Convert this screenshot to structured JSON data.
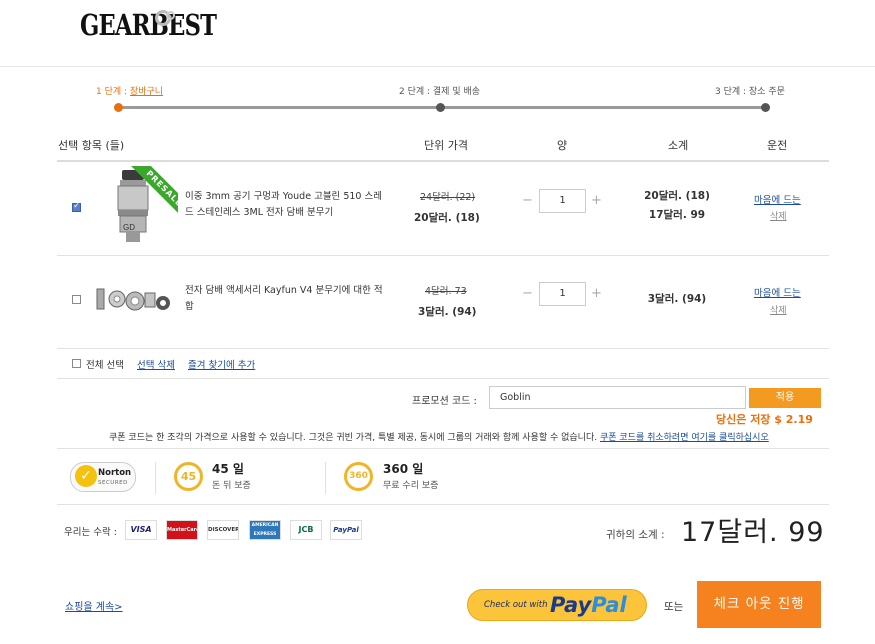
{
  "header": {
    "logo": "GEARBEST"
  },
  "steps": [
    {
      "num": "1 단계 :",
      "label": "장바구니"
    },
    {
      "num": "",
      "label": "2 단계 : 결제 및 배송"
    },
    {
      "num": "",
      "label": "3 단계 : 장소 주문"
    }
  ],
  "table_headers": [
    "선택 항목 (들)",
    "단위 가격",
    "양",
    "소계",
    "운전"
  ],
  "items": [
    {
      "checked": true,
      "badge": "PRESALE",
      "name": "이중 3mm 공기 구멍과 Youde 고블린 510 스레드 스테인레스 3ML 전자 담배 분무기",
      "old_price": "24달러. (22)",
      "new_price": "20달러. (18)",
      "qty": "1",
      "subtotal_line1": "20달러. (18)",
      "subtotal_line2": "17달러. 99",
      "wishlist": "마음에 드는",
      "delete": "삭제"
    },
    {
      "checked": false,
      "name": "전자 담배 액세서리 Kayfun V4 분무기에 대한 적합",
      "old_price": "4달러. 73",
      "new_price": "3달러. (94)",
      "qty": "1",
      "subtotal_line1": "3달러. (94)",
      "wishlist": "마음에 드는",
      "delete": "삭제"
    }
  ],
  "bulk": {
    "select_all": "전체 선택",
    "delete_selected": "선택 삭제",
    "add_favorites": "즐겨 찾기에 추가"
  },
  "qty_controls": {
    "minus": "−",
    "plus": "+"
  },
  "promo": {
    "label": "프로모션 코드 :",
    "value": "Goblin",
    "apply": "적용",
    "savings": "당신은 저장 $ 2.19",
    "note": "쿠폰 코드는 한 조각의 가격으로 사용할 수 있습니다. 그것은 귀빈 가격, 특별 제공, 동시에 그룹의 거래와 함께 사용할 수 없습니다.",
    "cancel_link": "쿠폰 코드를 취소하려면 여기를 클릭하십시오"
  },
  "trust": {
    "norton": {
      "title": "Norton",
      "sub": "SECURED"
    },
    "b1": {
      "circle": "45",
      "title": "45 일",
      "sub": "돈 뒤 보증"
    },
    "b2": {
      "circle": "360",
      "title": "360 일",
      "sub": "무료 수리 보증"
    }
  },
  "payment": {
    "label": "우리는 수락 :",
    "cards": [
      "VISA",
      "MasterCard",
      "DISCOVER",
      "AMERICAN EXPRESS",
      "JCB",
      "PayPal"
    ]
  },
  "summary": {
    "label": "귀하의 소계 :",
    "value": "17달러. 99"
  },
  "footer": {
    "continue": "쇼핑을 계속>",
    "paypal_prefix": "Check out with",
    "paypal_pay": "Pay",
    "paypal_pal": "Pal",
    "or": "또는",
    "checkout": "체크 아웃 진행"
  },
  "colors": {
    "accent": "#e8700a",
    "button": "#f5821f",
    "link": "#1a4b9c",
    "presale": "#3aa82b",
    "badge": "#f0b429"
  }
}
